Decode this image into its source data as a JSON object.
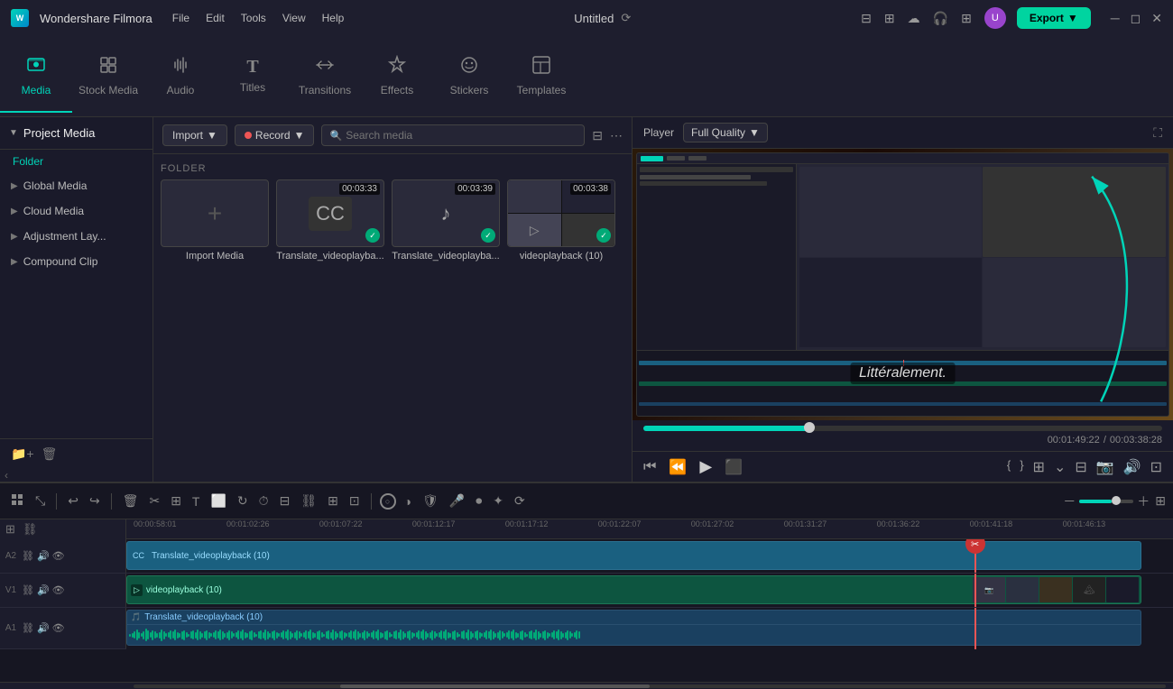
{
  "app": {
    "name": "Wondershare Filmora",
    "logo": "W",
    "title": "Untitled"
  },
  "menu": {
    "items": [
      "File",
      "Edit",
      "Tools",
      "View",
      "Help"
    ]
  },
  "title_icons": [
    "sync",
    "bell",
    "cloud",
    "headphones",
    "apps",
    "avatar"
  ],
  "export_btn": "Export",
  "window_controls": [
    "—",
    "⬜",
    "✕"
  ],
  "toolbar": {
    "items": [
      {
        "id": "media",
        "icon": "🎬",
        "label": "Media",
        "active": true
      },
      {
        "id": "stock",
        "icon": "📦",
        "label": "Stock Media",
        "active": false
      },
      {
        "id": "audio",
        "icon": "🎵",
        "label": "Audio",
        "active": false
      },
      {
        "id": "titles",
        "icon": "T",
        "label": "Titles",
        "active": false
      },
      {
        "id": "transitions",
        "icon": "↔",
        "label": "Transitions",
        "active": false
      },
      {
        "id": "effects",
        "icon": "✨",
        "label": "Effects",
        "active": false
      },
      {
        "id": "stickers",
        "icon": "☺",
        "label": "Stickers",
        "active": false
      },
      {
        "id": "templates",
        "icon": "⊞",
        "label": "Templates",
        "active": false
      }
    ]
  },
  "sidebar": {
    "header": "Project Media",
    "folder_label": "Folder",
    "items": [
      {
        "label": "Global Media"
      },
      {
        "label": "Cloud Media"
      },
      {
        "label": "Adjustment Lay..."
      },
      {
        "label": "Compound Clip"
      }
    ]
  },
  "media": {
    "import_label": "Import",
    "record_label": "Record",
    "search_placeholder": "Search media",
    "folder_section": "FOLDER",
    "items": [
      {
        "id": "import",
        "type": "add",
        "label": "Import Media",
        "time": null
      },
      {
        "id": "translate1",
        "type": "cc",
        "label": "Translate_videoplayba...",
        "time": "00:03:33",
        "checked": true
      },
      {
        "id": "translate2",
        "type": "music",
        "label": "Translate_videoplayba...",
        "time": "00:03:39",
        "checked": true
      },
      {
        "id": "video1",
        "type": "video",
        "label": "videoplayback (10)",
        "time": "00:03:38",
        "checked": true
      }
    ]
  },
  "player": {
    "label": "Player",
    "quality": "Full Quality",
    "subtitle": "Littéralement.",
    "current_time": "00:01:49:22",
    "total_time": "00:03:38:28",
    "progress_pct": 32
  },
  "timeline": {
    "rulers": [
      "00:00:58:01",
      "00:01:02:26",
      "00:01:07:22",
      "00:01:12:17",
      "00:01:17:12",
      "00:01:22:07",
      "00:01:27:02",
      "00:01:31:27",
      "00:01:36:22",
      "00:01:41:18",
      "00:01:46:13"
    ],
    "tracks": [
      {
        "id": "track-a2",
        "num": "A2",
        "type": "audio",
        "icons": [
          "link",
          "speaker",
          "eye"
        ],
        "clip": {
          "label": "Translate_videoplayback (10)",
          "type": "blue",
          "left": "0%",
          "width": "95%"
        }
      },
      {
        "id": "track-v1",
        "num": "V1",
        "type": "video",
        "icons": [
          "link",
          "speaker",
          "eye"
        ],
        "clip": {
          "label": "videoplayback (10)",
          "type": "teal",
          "left": "0%",
          "width": "95%"
        }
      },
      {
        "id": "track-a1",
        "num": "A1",
        "type": "audio",
        "icons": [
          "link",
          "speaker",
          "eye"
        ],
        "clip": {
          "label": "Translate_videoplayback (10)",
          "type": "audio",
          "left": "0%",
          "width": "95%",
          "waveform": true
        }
      }
    ]
  }
}
